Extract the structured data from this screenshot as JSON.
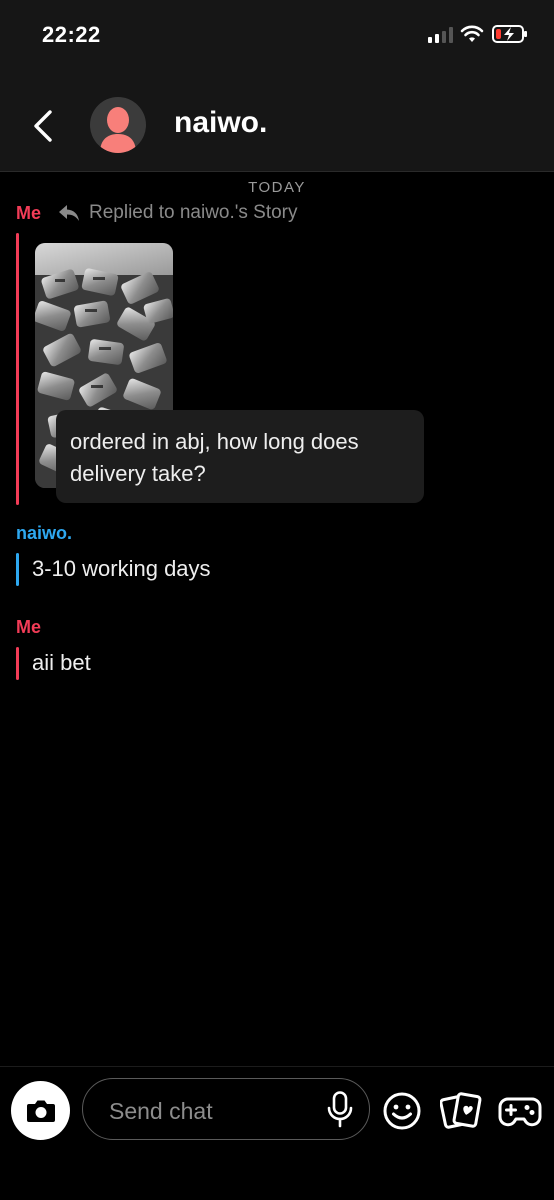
{
  "status_bar": {
    "time": "22:22"
  },
  "header": {
    "contact_name": "naiwo."
  },
  "conversation": {
    "date_label": "TODAY",
    "messages": [
      {
        "sender": "Me",
        "reply_label": "Replied to naiwo.'s Story",
        "text_line1": "ordered in abj, how long does",
        "text_line2": "delivery take?"
      },
      {
        "sender": "naiwo.",
        "text": "3-10 working days"
      },
      {
        "sender": "Me",
        "text": "aii bet"
      }
    ]
  },
  "composer": {
    "placeholder": "Send chat"
  },
  "icons": [
    "back-icon",
    "avatar-icon",
    "reply-arrow-icon",
    "camera-icon",
    "microphone-icon",
    "emoji-icon",
    "cards-icon",
    "game-controller-icon"
  ],
  "colors": {
    "me": "#f23c57",
    "them": "#2ea8f0",
    "background": "#000000"
  }
}
